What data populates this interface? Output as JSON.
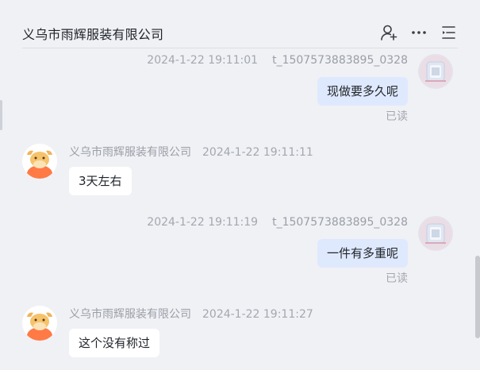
{
  "header": {
    "title": "义乌市雨辉服装有限公司",
    "icons": [
      "add-person-icon",
      "more-icon",
      "menu-list-icon"
    ]
  },
  "messages": [
    {
      "direction": "out",
      "sender": "t_1507573883895_0328",
      "time": "2024-1-22 19:11:01",
      "text": "现做要多久呢",
      "status": "已读"
    },
    {
      "direction": "in",
      "sender": "义乌市雨辉服装有限公司",
      "time": "2024-1-22 19:11:11",
      "text": "3天左右"
    },
    {
      "direction": "out",
      "sender": "t_1507573883895_0328",
      "time": "2024-1-22 19:11:19",
      "text": "一件有多重呢",
      "status": "已读"
    },
    {
      "direction": "in",
      "sender": "义乌市雨辉服装有限公司",
      "time": "2024-1-22 19:11:27",
      "text": "这个没有称过"
    }
  ],
  "colors": {
    "background": "#f0f1f5",
    "outgoing_bubble": "#dfe9fd",
    "incoming_bubble": "#ffffff",
    "meta_text": "#a3a7af",
    "avatar_shop": "#ff7a45"
  }
}
